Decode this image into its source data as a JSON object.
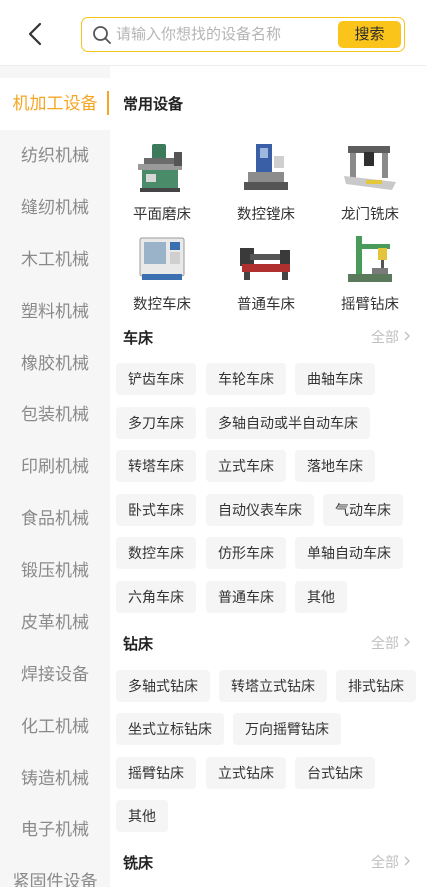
{
  "search": {
    "placeholder": "请输入你想找的设备名称",
    "button_label": "搜索"
  },
  "sidebar": {
    "items": [
      {
        "label": "机加工设备",
        "active": true
      },
      {
        "label": "纺织机械"
      },
      {
        "label": "缝纫机械"
      },
      {
        "label": "木工机械"
      },
      {
        "label": "塑料机械"
      },
      {
        "label": "橡胶机械"
      },
      {
        "label": "包装机械"
      },
      {
        "label": "印刷机械"
      },
      {
        "label": "食品机械"
      },
      {
        "label": "锻压机械"
      },
      {
        "label": "皮革机械"
      },
      {
        "label": "焊接设备"
      },
      {
        "label": "化工机械"
      },
      {
        "label": "铸造机械"
      },
      {
        "label": "电子机械"
      },
      {
        "label": "紧固件设备"
      }
    ]
  },
  "common": {
    "title": "常用设备",
    "items": [
      {
        "label": "平面磨床",
        "icon": "surface-grinder-icon"
      },
      {
        "label": "数控镗床",
        "icon": "cnc-boring-machine-icon"
      },
      {
        "label": "龙门铣床",
        "icon": "gantry-milling-machine-icon"
      },
      {
        "label": "数控车床",
        "icon": "cnc-lathe-icon"
      },
      {
        "label": "普通车床",
        "icon": "lathe-icon"
      },
      {
        "label": "摇臂钻床",
        "icon": "radial-drill-icon"
      }
    ]
  },
  "sections": [
    {
      "title": "车床",
      "all_label": "全部",
      "tags": [
        "铲齿车床",
        "车轮车床",
        "曲轴车床",
        "多刀车床",
        "多轴自动或半自动车床",
        "转塔车床",
        "立式车床",
        "落地车床",
        "卧式车床",
        "自动仪表车床",
        "气动车床",
        "数控车床",
        "仿形车床",
        "单轴自动车床",
        "六角车床",
        "普通车床",
        "其他"
      ]
    },
    {
      "title": "钻床",
      "all_label": "全部",
      "tags": [
        "多轴式钻床",
        "转塔立式钻床",
        "排式钻床",
        "坐式立标钻床",
        "万向摇臂钻床",
        "摇臂钻床",
        "立式钻床",
        "台式钻床",
        "其他"
      ]
    },
    {
      "title": "铣床",
      "all_label": "全部",
      "tags": []
    }
  ],
  "colors": {
    "accent": "#f5a623",
    "search_button": "#fbc41b",
    "search_border": "#f5c51a",
    "sidebar_bg": "#f6f6f6",
    "chip_bg": "#f5f5f5"
  }
}
